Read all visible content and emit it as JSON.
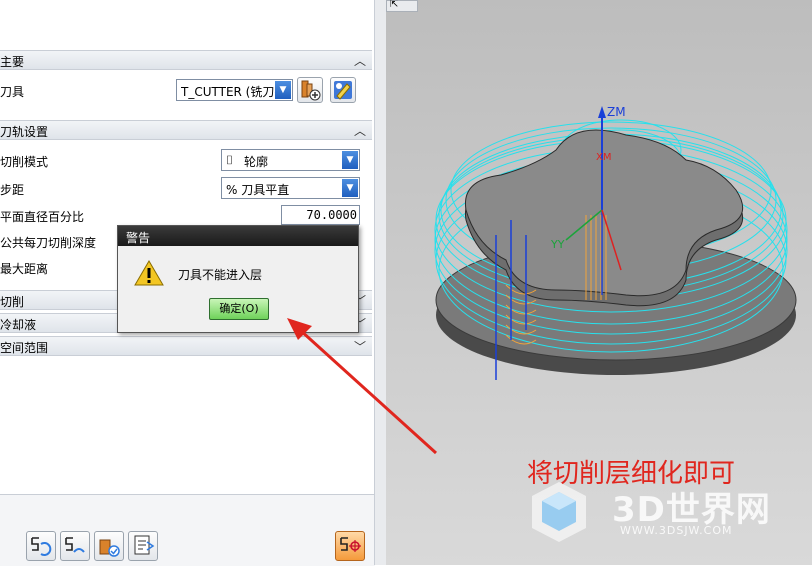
{
  "panel": {
    "sections": {
      "main": "主要",
      "toolpath": "刀轨设置",
      "cutting": "切削",
      "coolant": "冷却液",
      "spatial": "空间范围"
    },
    "tool_label": "刀具",
    "tool_value": "T_CUTTER (铣刀-",
    "cut_mode_label": "切削模式",
    "cut_mode_value": "轮廓",
    "stepover_label": "步距",
    "stepover_value": "% 刀具平直",
    "flat_diam_label": "平面直径百分比",
    "flat_diam_value": "70.0000",
    "depth_label": "公共每刀切削深度",
    "max_dist_label": "最大距离"
  },
  "dialog": {
    "title": "警告",
    "message": "刀具不能进入层",
    "ok_label": "确定(O)"
  },
  "viewport": {
    "axis_zm": "ZM",
    "axis_y": "YY",
    "axis_x": "XM"
  },
  "annotation": {
    "text": "将切削层细化即可",
    "color": "#e0261e"
  },
  "watermark": {
    "brand": "3D世界网",
    "url": "WWW.3DSJW.COM"
  },
  "icons": [
    "dropdown-arrow-icon",
    "new-tool-icon",
    "edit-tool-icon",
    "chevron-up-icon",
    "chevron-down-icon",
    "warning-icon",
    "generate-icon",
    "replay-icon",
    "verify-icon",
    "list-icon",
    "settings-icon",
    "undock-icon"
  ]
}
